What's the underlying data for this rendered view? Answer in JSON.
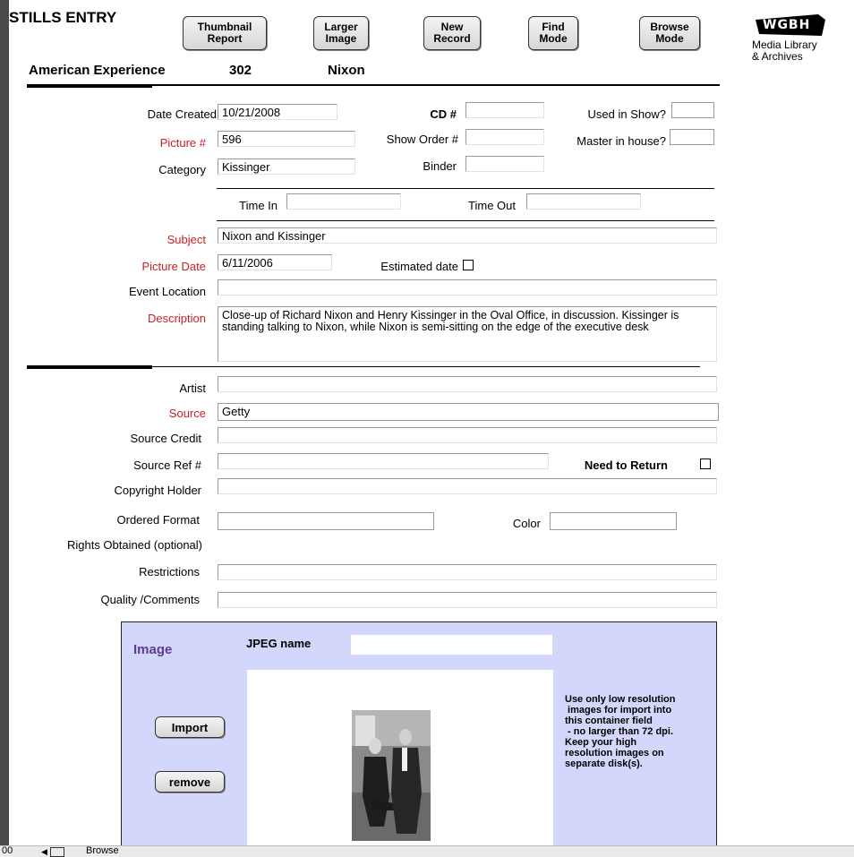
{
  "header": {
    "title": "STILLS ENTRY",
    "series": "American Experience",
    "episode": "302",
    "episode_title": "Nixon"
  },
  "toolbar": {
    "thumbnail_report": "Thumbnail\nReport",
    "larger_image": "Larger\nImage",
    "new_record": "New\nRecord",
    "find_mode": "Find\nMode",
    "browse_mode": "Browse\nMode"
  },
  "logo": {
    "mark": "WGBH",
    "line1": "Media Library",
    "line2": "& Archives"
  },
  "labels": {
    "date_created": "Date Created",
    "cd_number": "CD #",
    "used_in_show": "Used in Show?",
    "picture_number": "Picture #",
    "show_order": "Show Order #",
    "master_in_house": "Master in house?",
    "category": "Category",
    "binder": "Binder",
    "time_in": "Time In",
    "time_out": "Time Out",
    "subject": "Subject",
    "picture_date": "Picture Date",
    "estimated_date": "Estimated date",
    "event_location": "Event Location",
    "description": "Description",
    "artist": "Artist",
    "source": "Source",
    "source_credit": "Source Credit",
    "source_ref": "Source Ref #",
    "need_to_return": "Need to Return",
    "copyright_holder": "Copyright Holder",
    "ordered_format": "Ordered Format",
    "color": "Color",
    "rights_obtained": "Rights Obtained (optional)",
    "restrictions": "Restrictions",
    "quality_comments": "Quality /Comments"
  },
  "fields": {
    "date_created": "10/21/2008",
    "cd_number": "",
    "used_in_show": "",
    "picture_number": "596",
    "show_order": "",
    "master_in_house": "",
    "category": "Kissinger",
    "binder": "",
    "time_in": "",
    "time_out": "",
    "subject": "Nixon and Kissinger",
    "picture_date": "6/11/2006",
    "event_location": "",
    "description": "Close-up of Richard Nixon and Henry Kissinger in the Oval Office, in discussion.  Kissinger is standing talking to Nixon, while Nixon is semi-sitting on the edge of the executive desk",
    "artist": "",
    "source": "Getty",
    "source_credit": "",
    "source_ref": "",
    "copyright_holder": "",
    "ordered_format": "",
    "color": "",
    "restrictions": "",
    "quality_comments": ""
  },
  "image_panel": {
    "heading": "Image",
    "jpeg_label": "JPEG name",
    "jpeg_name": "",
    "import_button": "Import",
    "remove_button": "remove",
    "note": "Use only low resolution\n images for import into\nthis container field\n - no larger than 72 dpi.\nKeep your high\nresolution images on\nseparate disk(s)."
  },
  "statusbar": {
    "zoom": "00",
    "mode": "Browse"
  },
  "colors": {
    "required_label": "#c8202a",
    "panel_bg": "#d3d7fb",
    "panel_heading": "#5b3d8c"
  }
}
